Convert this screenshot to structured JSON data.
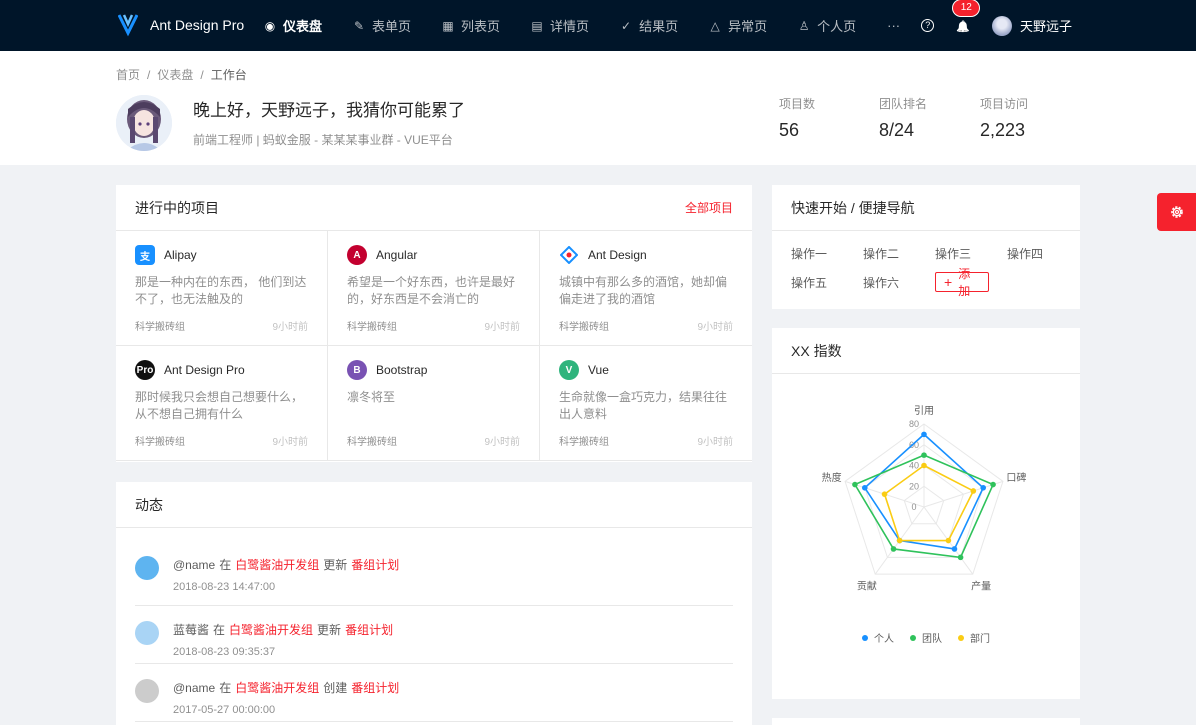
{
  "nav": {
    "brand": "Ant Design Pro",
    "menu": [
      {
        "label": "仪表盘",
        "icon": "dashboard-icon",
        "glyph": "◉",
        "active": true
      },
      {
        "label": "表单页",
        "icon": "form-icon",
        "glyph": "✎"
      },
      {
        "label": "列表页",
        "icon": "table-icon",
        "glyph": "▦"
      },
      {
        "label": "详情页",
        "icon": "profile-icon",
        "glyph": "▤"
      },
      {
        "label": "结果页",
        "icon": "check-circle-icon",
        "glyph": "✓"
      },
      {
        "label": "异常页",
        "icon": "warning-icon",
        "glyph": "△"
      },
      {
        "label": "个人页",
        "icon": "user-icon",
        "glyph": "♙"
      }
    ],
    "more": "···",
    "help_glyph": "?",
    "bell_glyph": "🔔",
    "notification_count": "12",
    "username": "天野远子"
  },
  "breadcrumb": [
    "首页",
    "仪表盘",
    "工作台"
  ],
  "header": {
    "greeting": "晚上好，天野远子，我猜你可能累了",
    "subtitle": "前端工程师 | 蚂蚁金服 - 某某某事业群 - VUE平台",
    "stats": [
      {
        "label": "项目数",
        "value": "56"
      },
      {
        "label": "团队排名",
        "value": "8/24"
      },
      {
        "label": "项目访问",
        "value": "2,223"
      }
    ]
  },
  "projects": {
    "title": "进行中的项目",
    "extra": "全部项目",
    "items": [
      {
        "name": "Alipay",
        "desc": "那是一种内在的东西， 他们到达不了，也无法触及的",
        "group": "科学搬砖组",
        "time": "9小时前",
        "logo_color": "#1890ff",
        "logo_text": "支"
      },
      {
        "name": "Angular",
        "desc": "希望是一个好东西，也许是最好的，好东西是不会消亡的",
        "group": "科学搬砖组",
        "time": "9小时前",
        "logo_color": "#c3002f",
        "logo_text": "A"
      },
      {
        "name": "Ant Design",
        "desc": "城镇中有那么多的酒馆，她却偏偏走进了我的酒馆",
        "group": "科学搬砖组",
        "time": "9小时前",
        "logo_color": "#ffffff",
        "logo_text": ""
      },
      {
        "name": "Ant Design Pro",
        "desc": "那时候我只会想自己想要什么，从不想自己拥有什么",
        "group": "科学搬砖组",
        "time": "9小时前",
        "logo_color": "#111111",
        "logo_text": "Pro"
      },
      {
        "name": "Bootstrap",
        "desc": "凛冬将至",
        "group": "科学搬砖组",
        "time": "9小时前",
        "logo_color": "#7952b3",
        "logo_text": "B"
      },
      {
        "name": "Vue",
        "desc": "生命就像一盒巧克力，结果往往出人意料",
        "group": "科学搬砖组",
        "time": "9小时前",
        "logo_color": "#2fb47d",
        "logo_text": "V"
      }
    ]
  },
  "activity": {
    "title": "动态",
    "items": [
      {
        "user": "@name",
        "in": "在",
        "group": "白鹭酱油开发组",
        "action": "更新",
        "target": "番组计划",
        "time": "2018-08-23 14:47:00",
        "avatar_color": "#5eb4f0"
      },
      {
        "user": "蓝莓酱",
        "in": "在",
        "group": "白鹭酱油开发组",
        "action": "更新",
        "target": "番组计划",
        "time": "2018-08-23 09:35:37",
        "avatar_color": "#a9d4f5"
      },
      {
        "user": "@name",
        "in": "在",
        "group": "白鹭酱油开发组",
        "action": "创建",
        "target": "番组计划",
        "time": "2017-05-27 00:00:00",
        "avatar_color": "#cccccc"
      }
    ]
  },
  "quick": {
    "title": "快速开始 / 便捷导航",
    "items": [
      "操作一",
      "操作二",
      "操作三",
      "操作四",
      "操作五",
      "操作六"
    ],
    "add_label": "添加"
  },
  "xx_index": {
    "title": "XX 指数"
  },
  "chart_data": {
    "type": "radar",
    "indicators": [
      "引用",
      "口碑",
      "产量",
      "贡献",
      "热度"
    ],
    "max": 80,
    "ticks": [
      "80",
      "60",
      "40",
      "20",
      "0"
    ],
    "series": [
      {
        "name": "个人",
        "color": "#1890ff",
        "values": [
          70,
          60,
          50,
          40,
          60
        ]
      },
      {
        "name": "团队",
        "color": "#2fc25b",
        "values": [
          50,
          70,
          60,
          50,
          70
        ]
      },
      {
        "name": "部门",
        "color": "#facc14",
        "values": [
          40,
          50,
          40,
          40,
          40
        ]
      }
    ]
  }
}
